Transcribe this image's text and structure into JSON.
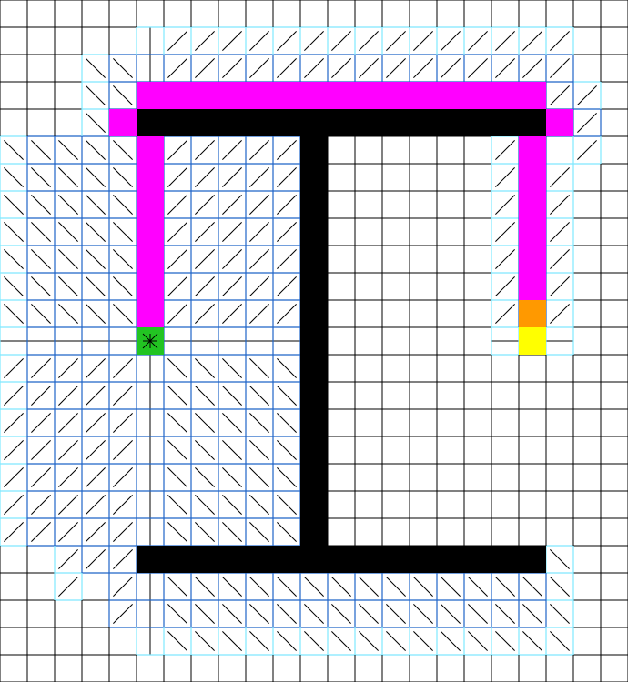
{
  "grid": {
    "cols": 23,
    "rows": 25
  },
  "colors": {
    "background": "#ffffff",
    "grid_line": "#000000",
    "explored_line": "#1e64c8",
    "frontier_line": "#7fe8ff",
    "wall": "#000000",
    "path": "#ff00ff",
    "start": "#22c422",
    "goal": "#ffff00",
    "current": "#ff9900",
    "parent_arrow": "#000000"
  },
  "walls": [
    {
      "c0": 5,
      "c1": 19,
      "r0": 4,
      "r1": 4
    },
    {
      "c0": 11,
      "c1": 11,
      "r0": 5,
      "r1": 19
    },
    {
      "c0": 5,
      "c1": 19,
      "r0": 20,
      "r1": 20
    }
  ],
  "explored_regions": [
    {
      "c0": 1,
      "c1": 10,
      "r0": 5,
      "r1": 19
    },
    {
      "c0": 4,
      "c1": 4,
      "r0": 2,
      "r1": 4
    },
    {
      "c0": 5,
      "c1": 20,
      "r0": 2,
      "r1": 3
    },
    {
      "c0": 20,
      "c1": 21,
      "r0": 4,
      "r1": 4
    },
    {
      "c0": 19,
      "c1": 19,
      "r0": 5,
      "r1": 11
    },
    {
      "c0": 4,
      "c1": 19,
      "r0": 21,
      "r1": 22
    },
    {
      "c0": 3,
      "c1": 4,
      "r0": 20,
      "r1": 20
    }
  ],
  "frontier_regions": [
    {
      "c0": 5,
      "c1": 20,
      "r0": 1,
      "r1": 1
    },
    {
      "c0": 3,
      "c1": 3,
      "r0": 2,
      "r1": 4
    },
    {
      "c0": 0,
      "c1": 0,
      "r0": 5,
      "r1": 19
    },
    {
      "c0": 21,
      "c1": 21,
      "r0": 3,
      "r1": 3
    },
    {
      "c0": 21,
      "c1": 21,
      "r0": 5,
      "r1": 5
    },
    {
      "c0": 18,
      "c1": 18,
      "r0": 5,
      "r1": 12
    },
    {
      "c0": 20,
      "c1": 20,
      "r0": 6,
      "r1": 12
    },
    {
      "c0": 5,
      "c1": 20,
      "r0": 23,
      "r1": 23
    },
    {
      "c0": 20,
      "c1": 20,
      "r0": 20,
      "r1": 22
    },
    {
      "c0": 2,
      "c1": 2,
      "r0": 19,
      "r1": 21
    }
  ],
  "path_cells": [
    [
      4,
      4
    ],
    [
      5,
      4
    ],
    [
      5,
      3
    ],
    [
      6,
      3
    ],
    [
      7,
      3
    ],
    [
      8,
      3
    ],
    [
      9,
      3
    ],
    [
      10,
      3
    ],
    [
      11,
      3
    ],
    [
      12,
      3
    ],
    [
      13,
      3
    ],
    [
      14,
      3
    ],
    [
      15,
      3
    ],
    [
      16,
      3
    ],
    [
      17,
      3
    ],
    [
      18,
      3
    ],
    [
      19,
      3
    ],
    [
      20,
      4
    ],
    [
      19,
      5
    ],
    [
      19,
      6
    ],
    [
      19,
      7
    ],
    [
      19,
      8
    ],
    [
      19,
      9
    ],
    [
      19,
      10
    ],
    [
      5,
      5
    ],
    [
      5,
      6
    ],
    [
      5,
      7
    ],
    [
      5,
      8
    ],
    [
      5,
      9
    ],
    [
      5,
      10
    ],
    [
      5,
      11
    ]
  ],
  "start_cell": [
    5,
    12
  ],
  "current_cell": [
    19,
    11
  ],
  "goal_cell": [
    19,
    12
  ]
}
